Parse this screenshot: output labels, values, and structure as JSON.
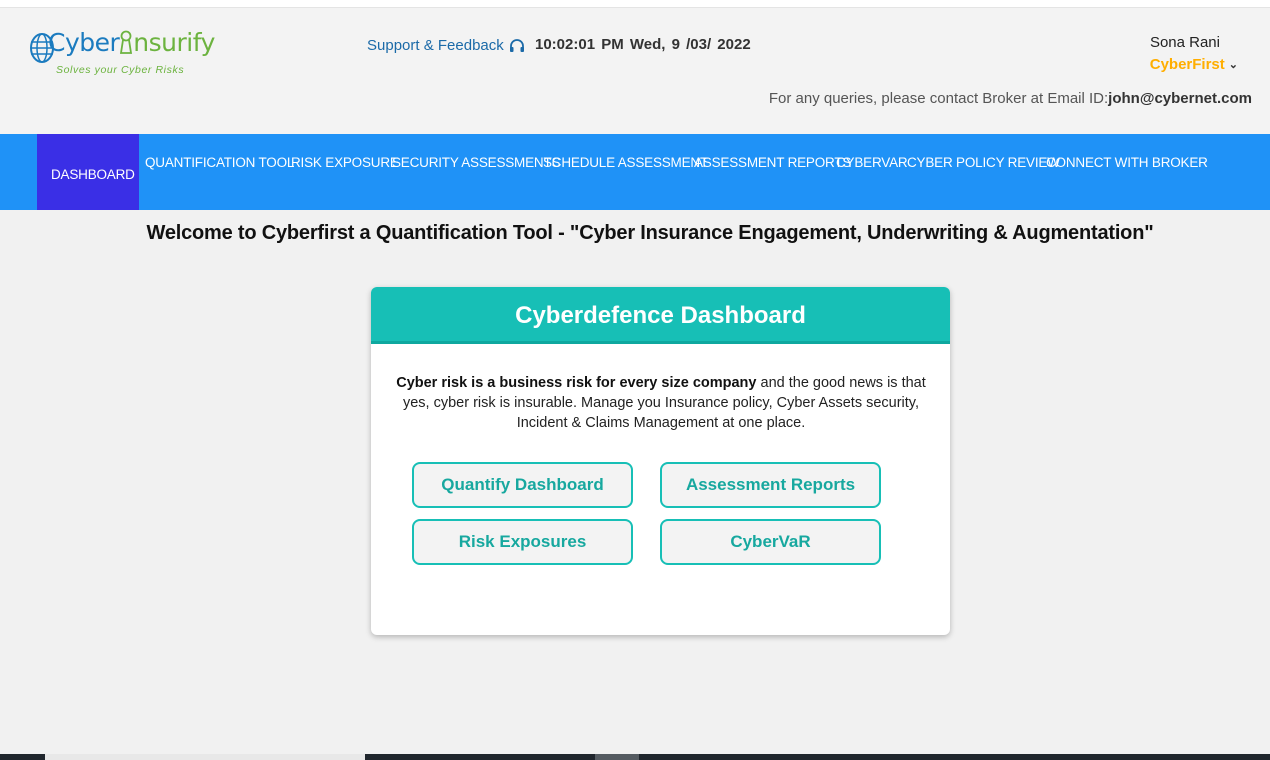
{
  "header": {
    "logo": {
      "text_main_part1": "Cyber",
      "text_main_part2": "nsurify",
      "tagline": "Solves your Cyber Risks",
      "globe_icon": "globe-icon",
      "keyhole_icon": "keyhole-icon"
    },
    "support_label": "Support & Feedback",
    "support_icon": "headset-icon",
    "datetime": "10:02:01 PM  Wed, 9 /03/ 2022",
    "user": {
      "name": "Sona Rani",
      "organization": "CyberFirst",
      "dropdown_icon": "chevron-down-icon"
    },
    "contact_prefix": "For any queries, please contact Broker at Email ID:",
    "contact_email": "john@cybernet.com"
  },
  "nav": {
    "items": [
      {
        "label": "DASHBOARD",
        "active": true
      },
      {
        "label": "QUANTIFICATION TOOL",
        "active": false
      },
      {
        "label": "RISK EXPOSURE",
        "active": false
      },
      {
        "label": "SECURITY ASSESSMENTS",
        "active": false
      },
      {
        "label": "SCHEDULE ASSESSMENT",
        "active": false
      },
      {
        "label": "ASSESSMENT REPORTS",
        "active": false
      },
      {
        "label": "CYBERVAR",
        "active": false
      },
      {
        "label": "CYBER POLICY REVIEW",
        "active": false
      },
      {
        "label": "CONNECT WITH BROKER",
        "active": false
      }
    ]
  },
  "main": {
    "welcome": "Welcome to Cyberfirst a Quantification Tool - \"Cyber Insurance Engagement, Underwriting & Augmentation\"",
    "card": {
      "title": "Cyberdefence Dashboard",
      "text_bold": "Cyber risk is a business risk for every size company",
      "text_rest": " and the good news is that yes, cyber risk is insurable. Manage you Insurance policy, Cyber Assets security, Incident & Claims Management at one place.",
      "buttons": [
        {
          "label": "Quantify Dashboard"
        },
        {
          "label": "Assessment Reports"
        },
        {
          "label": "Risk Exposures"
        },
        {
          "label": "CyberVaR"
        }
      ]
    }
  },
  "colors": {
    "nav_bg": "#1f92f7",
    "nav_active_bg": "#3a2fe6",
    "card_accent": "#17bfb6",
    "org_color": "#ffae00",
    "logo_blue": "#1b7bbf",
    "logo_green": "#6cb33f"
  }
}
